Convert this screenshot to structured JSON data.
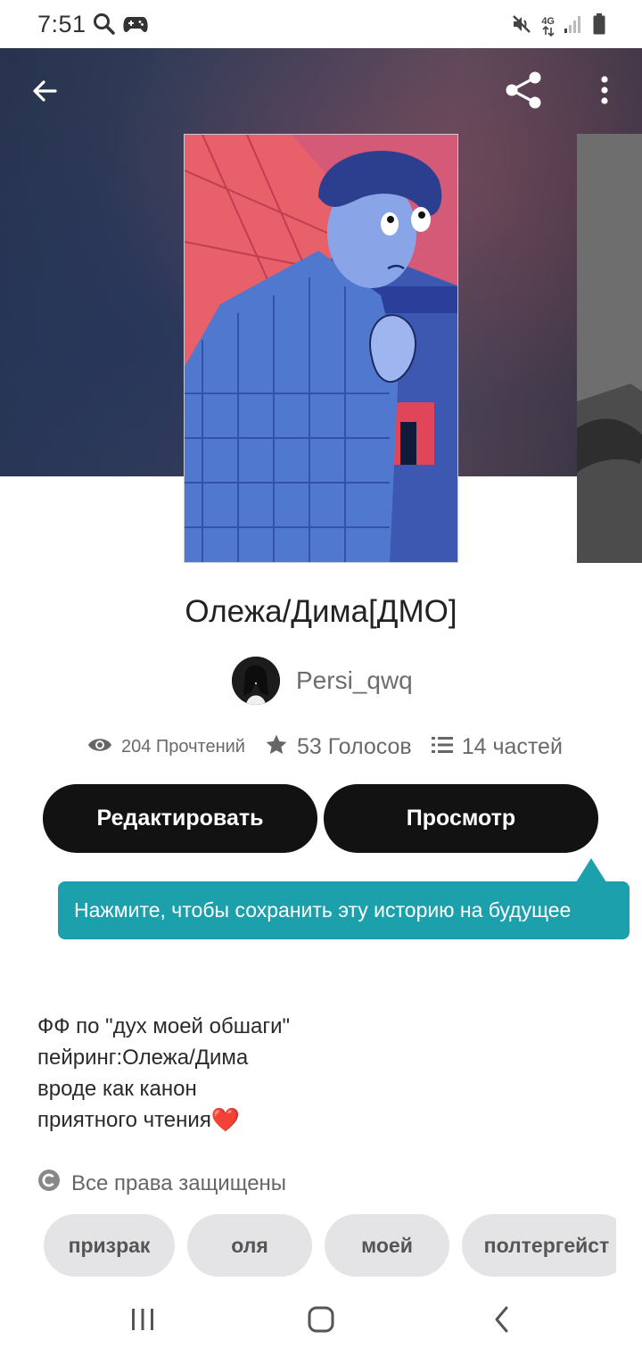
{
  "status_bar": {
    "time": "7:51",
    "icons": [
      "search-icon",
      "gamepad-icon",
      "mute-icon",
      "4g-icon",
      "signal-icon",
      "battery-icon"
    ],
    "network_label": "4G"
  },
  "toolbar": {
    "back_icon": "arrow-left-icon",
    "share_icon": "share-icon",
    "more_icon": "more-vertical-icon"
  },
  "story": {
    "title": "Олежа/Дима[ДМО]",
    "author": "Persi_qwq",
    "stats": {
      "reads": "204 Прочтений",
      "votes": "53 Голосов",
      "parts": "14 частей"
    },
    "buttons": {
      "edit": "Редактировать",
      "view": "Просмотр"
    },
    "tooltip": "Нажмите, чтобы сохранить эту историю на будущее",
    "description": [
      "ФФ по \"дух моей обшаги\"",
      "пейринг:Олежа/Дима",
      "вроде как канон",
      "приятного чтения"
    ],
    "description_emoji": "❤️",
    "copyright": "Все права защищены",
    "tags": [
      "призрак",
      "оля",
      "моей",
      "полтергейст"
    ]
  },
  "colors": {
    "button_bg": "#121212",
    "tooltip_bg": "#1ba0ac",
    "tag_bg": "#e4e4e6",
    "heart": "#e02424"
  },
  "nav_bar": {
    "icons": [
      "recent-apps-icon",
      "home-icon",
      "back-icon"
    ]
  }
}
